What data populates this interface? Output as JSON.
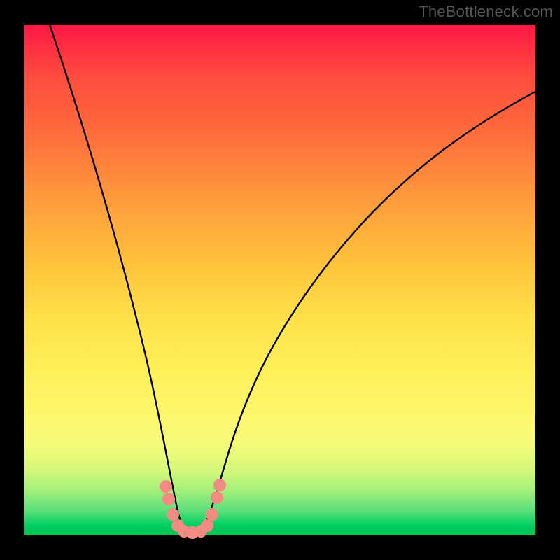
{
  "watermark": {
    "text": "TheBottleneck.com"
  },
  "chart_data": {
    "type": "line",
    "title": "",
    "xlabel": "",
    "ylabel": "",
    "xlim": [
      0,
      100
    ],
    "ylim": [
      0,
      100
    ],
    "series": [
      {
        "name": "bottleneck-curve",
        "x": [
          5,
          10,
          14,
          18,
          21,
          23,
          25,
          26.5,
          28,
          29,
          30,
          31,
          32,
          33,
          34,
          36,
          38,
          41,
          45,
          50,
          56,
          63,
          71,
          80,
          90,
          100
        ],
        "values": [
          100,
          84,
          70,
          56,
          42,
          32,
          22,
          14,
          7,
          3,
          1,
          0.5,
          1,
          3,
          7,
          14,
          23,
          33,
          43,
          52,
          60,
          67,
          73,
          78,
          82,
          85
        ]
      }
    ],
    "markers": {
      "name": "highlight-dots",
      "color": "#f28b82",
      "x": [
        25.5,
        26.2,
        27.3,
        28.5,
        29.8,
        31.0,
        32.2,
        33.5,
        34.5,
        35.5,
        36.3
      ],
      "values": [
        11.0,
        8.0,
        4.5,
        2.0,
        1.0,
        0.5,
        1.0,
        2.0,
        4.5,
        8.0,
        11.0
      ]
    }
  }
}
